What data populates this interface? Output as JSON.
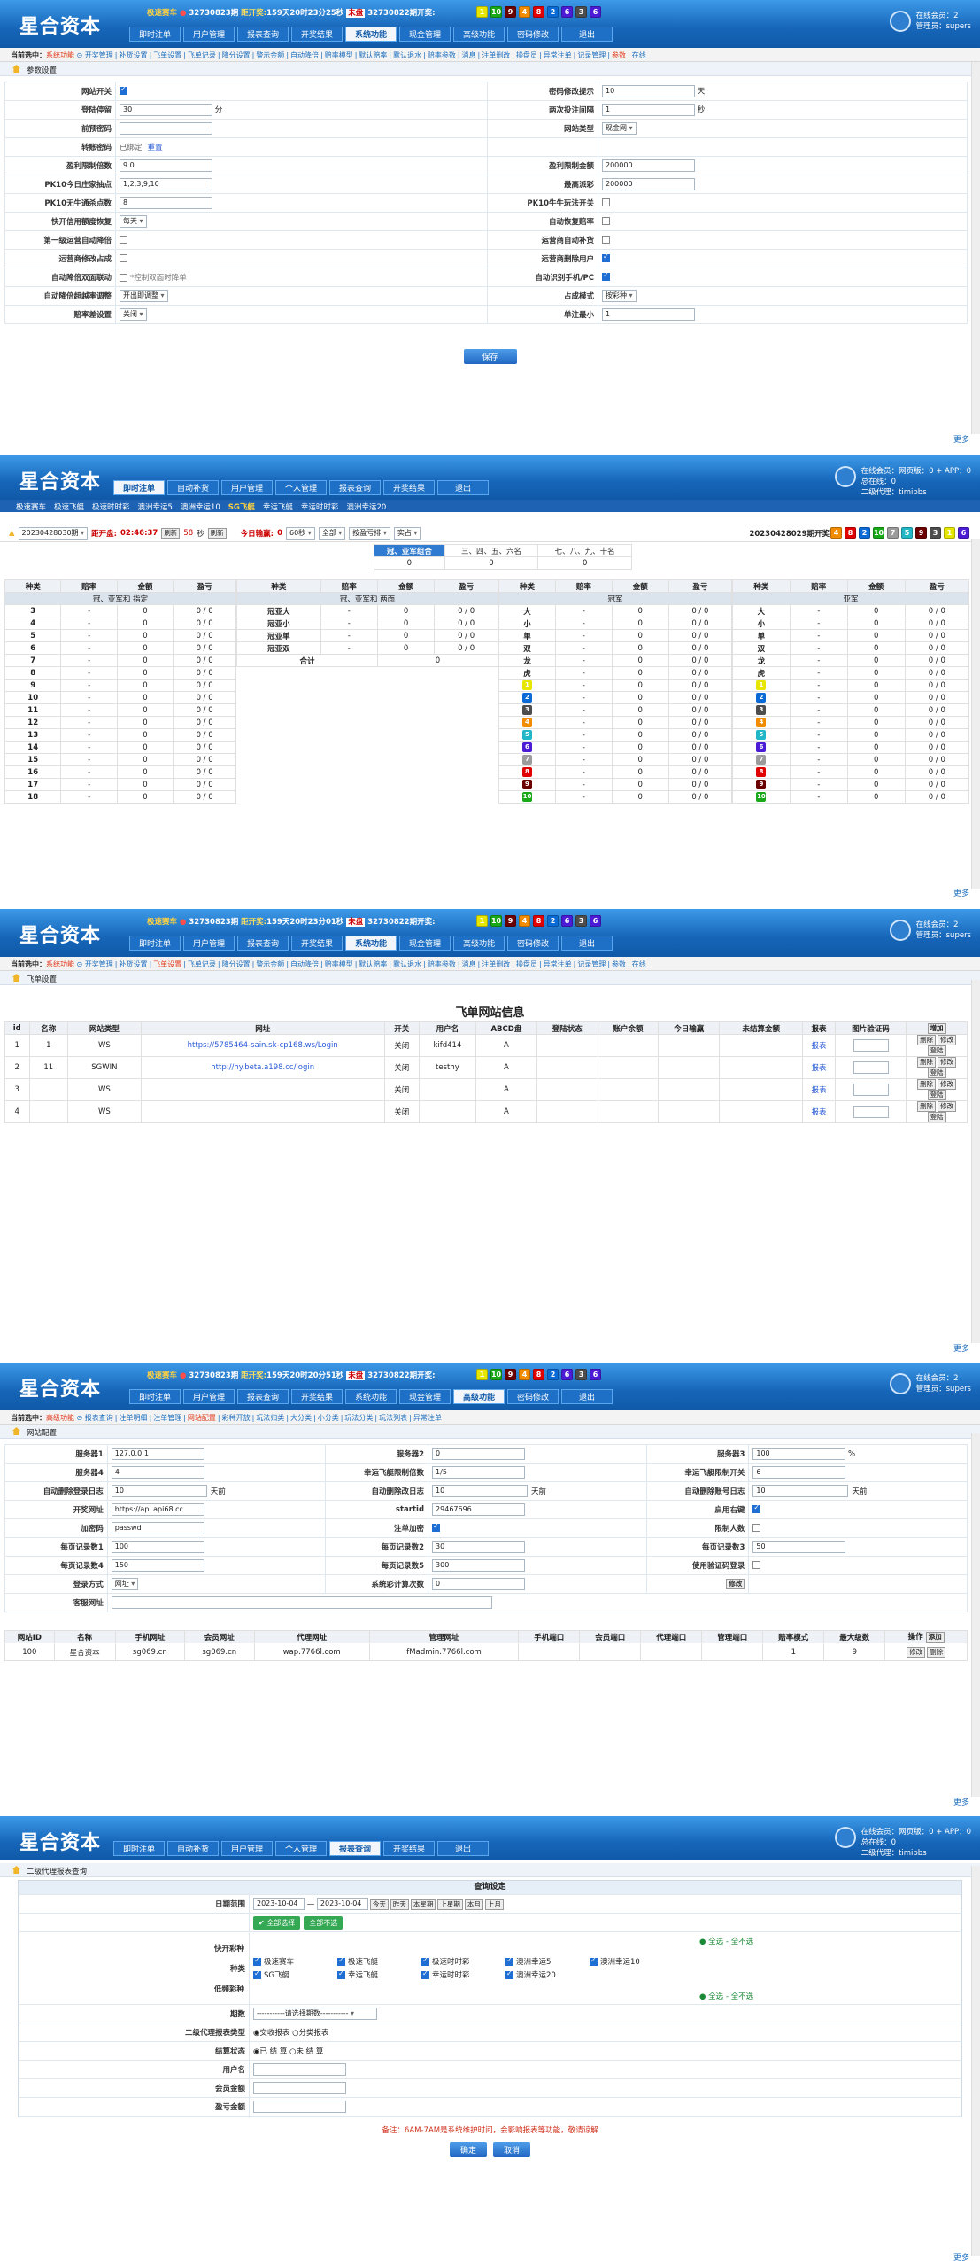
{
  "app": {
    "logo": "星合资本",
    "online_lines": [
      "在线会员：2",
      "管理员：supers"
    ]
  },
  "colors": {
    "ball1": "#e6e600",
    "ball2": "#0b6bd6",
    "ball3": "#4d4d4d",
    "ball4": "#f28c00",
    "ball5": "#22b7c6",
    "ball6": "#4b1bd6",
    "ball7": "#9b9b9b",
    "ball8": "#e00000",
    "ball9": "#6b0000",
    "ball10": "#18a818"
  },
  "s1": {
    "hint": {
      "game": "极速赛车",
      "issue_a": "32730823期",
      "open_label": "距开奖:",
      "time": "159天20时23分25秒",
      "tag": "未盘",
      "issue_b": "32730822期开奖:"
    },
    "balls": [
      "1",
      "10",
      "9",
      "4",
      "8",
      "2",
      "6",
      "3",
      "6"
    ],
    "nav": [
      "即时注单",
      "用户管理",
      "报表查询",
      "开奖结果",
      "系统功能",
      "现金管理",
      "高级功能",
      "密码修改",
      "退出"
    ],
    "crumb_prefix": "当前选中：",
    "crumb_cur": "系统功能",
    "crumb_items": [
      "开奖管理",
      "补货设置",
      "飞单设置",
      "飞单记录",
      "降分设置",
      "警示金额",
      "自动降倍",
      "赔率模型",
      "默认赔率",
      "默认退水",
      "赔率参数",
      "消息",
      "注单删改",
      "操盘员",
      "异常注单",
      "记录管理",
      "参数",
      "在线"
    ],
    "section_title": "参数设置",
    "rows": [
      {
        "l": "网站开关",
        "lv": "",
        "r": "密码修改提示",
        "rv": "10",
        "ru": "天"
      },
      {
        "l": "登陆停留",
        "lv": "30",
        "lu": "分",
        "r": "两次投注间隔",
        "rv": "1",
        "ru": "秒"
      },
      {
        "l": "前预密码",
        "lv": "",
        "r": "网站类型",
        "rv": "现金网"
      },
      {
        "l": "转账密码",
        "lv": "已绑定",
        "lv2": "重置",
        "r": "",
        "rv": ""
      },
      {
        "l": "盈利限制倍数",
        "lv": "9.0",
        "r": "盈利限制金额",
        "rv": "200000"
      },
      {
        "l": "PK10今日庄家抽点",
        "lv": "1,2,3,9,10",
        "r": "最高派彩",
        "rv": "200000"
      },
      {
        "l": "PK10无牛通杀点数",
        "lv": "8",
        "r": "PK10牛牛玩法开关",
        "rv": ""
      },
      {
        "l": "快开信用额度恢复",
        "lv": "每天",
        "r": "自动恢复赔率",
        "rv": ""
      },
      {
        "l": "第一级运营自动降倍",
        "lv": "",
        "r": "运营商自动补货",
        "rv": ""
      },
      {
        "l": "运营商修改占成",
        "lv": "",
        "r": "运营商删除用户",
        "rv": ""
      },
      {
        "l": "自动降倍双面联动",
        "lv": "*控制双面时降单",
        "r": "自动识别手机/PC",
        "rv": ""
      },
      {
        "l": "自动降倍超越率调整",
        "lv": "开出即调整",
        "r": "占成模式",
        "rv": "按彩种"
      },
      {
        "l": "赔率差设置",
        "lv": "关闭",
        "r": "单注最小",
        "rv": "1"
      }
    ],
    "save": "保存",
    "more": "更多"
  },
  "s2": {
    "nav": [
      "即时注单",
      "自动补货",
      "用户管理",
      "个人管理",
      "报表查询",
      "开奖结果",
      "退出"
    ],
    "online_lines": [
      "在线会员：网页版：0 + APP：0",
      "总在线：0",
      "二级代理：timibbs"
    ],
    "subnav": [
      "极速赛车",
      "极速飞艇",
      "极速时时彩",
      "澳洲幸运5",
      "澳洲幸运10",
      "SG飞艇",
      "幸运飞艇",
      "幸运时时彩",
      "澳洲幸运20"
    ],
    "bar": {
      "issue": "20230428030期",
      "close_label": "距开盘:",
      "close": "02:46:37",
      "tag": "刷新",
      "sec": "58",
      "sec_label": "秒",
      "refresh": "刷新",
      "today_label": "今日输赢:",
      "today": "0",
      "sel1": "60秒",
      "sel2": "全部",
      "sel3": "按盈亏排",
      "sel4": "实占",
      "right": "20230428029期开奖"
    },
    "balls": [
      "4",
      "8",
      "2",
      "10",
      "7",
      "5",
      "9",
      "3",
      "1",
      "6"
    ],
    "tabs": [
      "冠、亚军组合",
      "三、四、五、六名",
      "七、八、九、十名"
    ],
    "tabvals": [
      "0",
      "0",
      "0"
    ],
    "cols": [
      "种类",
      "赔率",
      "金额",
      "盈亏"
    ],
    "grp": [
      "冠、亚军和 指定",
      "冠、亚军和 两面",
      "冠军",
      "亚军"
    ],
    "left_nums": [
      "3",
      "4",
      "5",
      "6",
      "7",
      "8",
      "9",
      "10",
      "11",
      "12",
      "13",
      "14",
      "15",
      "16",
      "17",
      "18"
    ],
    "mid_items": [
      "冠亚大",
      "冠亚小",
      "冠亚单",
      "冠亚双"
    ],
    "total_label": "合计",
    "total": "0",
    "right_items": [
      "大",
      "小",
      "单",
      "双",
      "龙",
      "虎",
      "1",
      "2",
      "3",
      "4",
      "5",
      "6",
      "7",
      "8",
      "9",
      "10"
    ],
    "dash": "-",
    "zero": "0",
    "pl": "0 / 0",
    "more": "更多"
  },
  "s3": {
    "hint": {
      "game": "极速赛车",
      "issue_a": "32730823期",
      "open_label": "距开奖:",
      "time": "159天20时23分01秒",
      "tag": "未盘",
      "issue_b": "32730822期开奖:"
    },
    "crumb_cur": "系统功能",
    "section_title": "飞单设置",
    "title": "飞单网站信息",
    "cols": [
      "id",
      "名称",
      "网站类型",
      "网址",
      "开关",
      "用户名",
      "ABCD盘",
      "登陆状态",
      "账户余额",
      "今日输赢",
      "未结算金额",
      "报表",
      "图片验证码",
      "增加"
    ],
    "rows": [
      {
        "id": "1",
        "name": "1",
        "type": "WS",
        "url": "https://5785464-sain.sk-cp168.ws/Login",
        "sw": "关闭",
        "user": "kifd414",
        "pan": "A"
      },
      {
        "id": "2",
        "name": "11",
        "type": "SGWIN",
        "url": "http://hy.beta.a198.cc/login",
        "sw": "关闭",
        "user": "testhy",
        "pan": "A"
      },
      {
        "id": "3",
        "name": "",
        "type": "WS",
        "url": "",
        "sw": "关闭",
        "user": "",
        "pan": "A"
      },
      {
        "id": "4",
        "name": "",
        "type": "WS",
        "url": "",
        "sw": "关闭",
        "user": "",
        "pan": "A"
      }
    ],
    "report": "报表",
    "ops": [
      "删除",
      "修改",
      "登陆"
    ],
    "more": "更多"
  },
  "s4": {
    "hint": {
      "game": "极速赛车",
      "issue_a": "32730823期",
      "open_label": "距开奖:",
      "time": "159天20时20分51秒",
      "tag": "未盘",
      "issue_b": "32730822期开奖:"
    },
    "crumb_cur": "高级功能",
    "crumb_items": [
      "报表查询",
      "注单明细",
      "注单管理",
      "网站配置",
      "彩种开放",
      "玩法归类",
      "大分类",
      "小分类",
      "玩法分类",
      "玩法列表",
      "异常注单"
    ],
    "section_title": "网站配置",
    "rows": [
      [
        "服务器1",
        "127.0.0.1",
        "服务器2",
        "0",
        "服务器3",
        "100",
        "%"
      ],
      [
        "服务器4",
        "4",
        "幸运飞艇限制倍数",
        "1/5",
        "幸运飞艇限制开关",
        "6",
        ""
      ],
      [
        "自动删除登录日志",
        "10",
        "自动删除改日志",
        "10",
        "自动删除账号日志",
        "10",
        ""
      ],
      [
        "开奖网址",
        "https://api.api68.cc",
        "startid",
        "29467696",
        "启用右键",
        "",
        ""
      ],
      [
        "加密码",
        "passwd",
        "注单加密",
        "",
        "限制人数",
        "",
        ""
      ],
      [
        "每页记录数1",
        "100",
        "每页记录数2",
        "30",
        "每页记录数3",
        "50",
        ""
      ],
      [
        "每页记录数4",
        "150",
        "每页记录数5",
        "300",
        "使用验证码登录",
        "",
        ""
      ],
      [
        "登录方式",
        "网址",
        "系统彩计算次数",
        "0",
        "修改",
        "",
        ""
      ]
    ],
    "days": "天前",
    "kefu_label": "客服网址",
    "cols": [
      "网站ID",
      "名称",
      "手机网址",
      "会员网址",
      "代理网址",
      "管理网址",
      "手机端口",
      "会员端口",
      "代理端口",
      "管理端口",
      "赔率模式",
      "最大级数",
      "操作"
    ],
    "row": [
      "100",
      "星合资本",
      "sg069.cn",
      "sg069.cn",
      "wap.7766l.com",
      "fMadmin.7766l.com",
      "",
      "",
      "",
      "",
      "1",
      "9"
    ],
    "add": "添加",
    "ops": [
      "修改",
      "删除"
    ],
    "more": "更多"
  },
  "s5": {
    "nav": [
      "即时注单",
      "自动补货",
      "用户管理",
      "个人管理",
      "报表查询",
      "开奖结果",
      "退出"
    ],
    "online_lines": [
      "在线会员：网页版：0 + APP：0",
      "总在线：0",
      "二级代理：timibbs"
    ],
    "section_title": "二级代理报表查询",
    "title": "查询设定",
    "date_label": "日期范围",
    "d1": "2023-10-04",
    "d2": "2023-10-04",
    "quick": [
      "今天",
      "昨天",
      "本星期",
      "上星期",
      "本月",
      "上月"
    ],
    "sel_all": "全部选择",
    "unsel_all": "全部不选",
    "kind_label": "种类",
    "fast": "快开彩种",
    "low": "低频彩种",
    "games": [
      "极速赛车",
      "极速飞艇",
      "极速时时彩",
      "澳洲幸运5",
      "澳洲幸运10",
      "SG飞艇",
      "幸运飞艇",
      "幸运时时彩",
      "澳洲幸运20"
    ],
    "all_none": "全选 - 全不选",
    "issue_label": "期数",
    "issue_val": "-----------请选择期数-----------",
    "type_label": "二级代理报表类型",
    "t1": "交收报表",
    "t2": "分类报表",
    "st_label": "结算状态",
    "st1": "已 结 算",
    "st2": "未 结 算",
    "user_label": "用户名",
    "member_label": "会员金额",
    "pl_label": "盈亏金额",
    "note": "备注：6AM-7AM是系统维护时间，会影响报表等功能，敬请谅解",
    "ok": "确定",
    "cancel": "取消",
    "more": "更多"
  }
}
